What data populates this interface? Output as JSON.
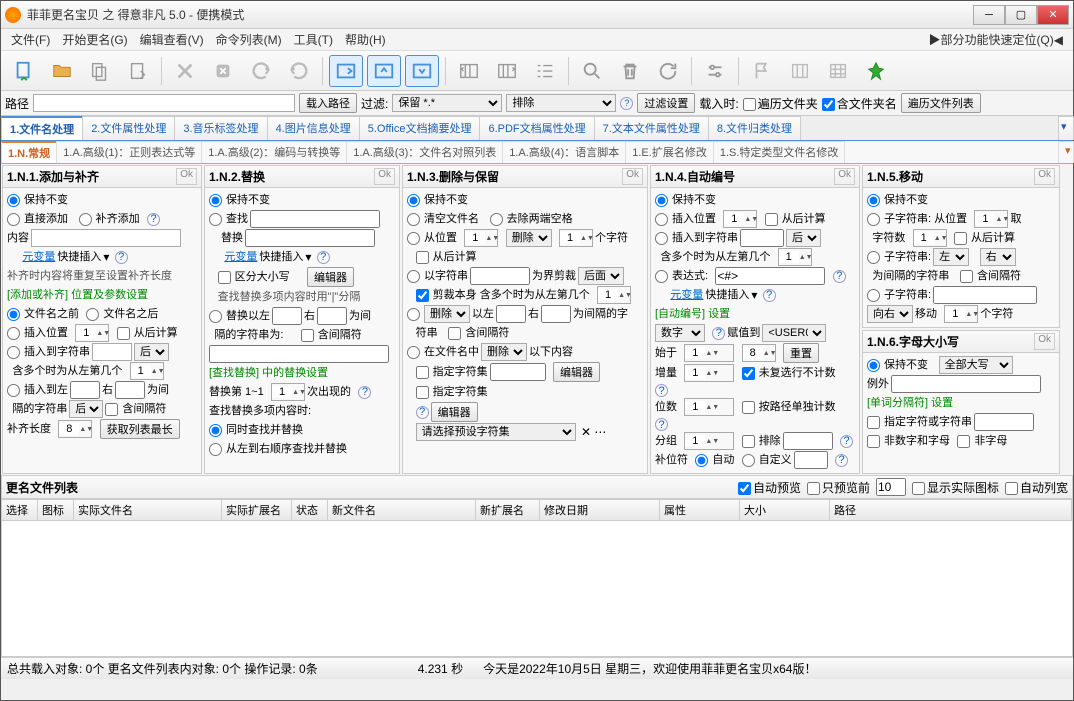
{
  "title": "菲菲更名宝贝 之 得意非凡 5.0 - 便携模式",
  "menu": [
    "文件(F)",
    "开始更名(G)",
    "编辑查看(V)",
    "命令列表(M)",
    "工具(T)",
    "帮助(H)"
  ],
  "menu_right": "▶部分功能快速定位(Q)◀",
  "pathbar": {
    "path_label": "路径",
    "load_path": "载入路径",
    "filter_label": "过滤:",
    "filter_keep": "保留 *.*",
    "sort": "排除",
    "filter_settings": "过滤设置",
    "load_time": "载入时:",
    "recurse": "遍历文件夹",
    "include_dirname": "含文件夹名",
    "recurse_list": "遍历文件列表"
  },
  "tabs1": [
    "1.文件名处理",
    "2.文件属性处理",
    "3.音乐标签处理",
    "4.图片信息处理",
    "5.Office文档摘要处理",
    "6.PDF文档属性处理",
    "7.文本文件属性处理",
    "8.文件归类处理"
  ],
  "tabs2": [
    "1.N.常规",
    "1.A.高级(1)：正则表达式等",
    "1.A.高级(2)：编码与转换等",
    "1.A.高级(3)：文件名对照列表",
    "1.A.高级(4)：语言脚本",
    "1.E.扩展名修改",
    "1.S.特定类型文件名修改"
  ],
  "p1": {
    "title": "1.N.1.添加与补齐",
    "keep": "保持不变",
    "direct": "直接添加",
    "pad": "补齐添加",
    "content": "内容",
    "varlink": "元变量",
    "vartext": "快捷插入",
    "padnote": "补齐时内容将重复至设置补齐长度",
    "section": "[添加或补齐] 位置及参数设置",
    "before": "文件名之前",
    "after": "文件名之后",
    "inspos": "插入位置",
    "fromback": "从后计算",
    "instostr": "插入到字符串",
    "houpos": "后",
    "multi": "含多个时为从左第几个",
    "insleft": "插入到左",
    "insright": "右",
    "between": "为间",
    "gapchar": "隔的字符串",
    "gapback": "后",
    "gapcontain": "含间隔符",
    "padlen": "补齐长度",
    "getmax": "获取列表最长"
  },
  "p2": {
    "title": "1.N.2.替换",
    "keep": "保持不变",
    "find": "查找",
    "replace": "替换",
    "varlink": "元变量",
    "vartext": "快捷插入",
    "casesen": "区分大小写",
    "editor": "编辑器",
    "multinote": "查找替换多项内容时用\"|\"分隔",
    "repleft": "替换以左",
    "repright": "右",
    "between": "为间",
    "gapstr": "隔的字符串为:",
    "gapcontain": "含间隔符",
    "section": "[查找替换] 中的替换设置",
    "repnth": "替换第 1~1",
    "times": "次出现的",
    "repmulti": "查找替换多项内容时:",
    "findrep": "同时查找并替换",
    "ltr": "从左到右顺序查找并替换"
  },
  "p3": {
    "title": "1.N.3.删除与保留",
    "keep": "保持不变",
    "clear": "清空文件名",
    "trim": "去除两端空格",
    "frompos": "从位置",
    "del": "删除",
    "chars": "个字符",
    "fromback": "从后计算",
    "bystr": "以字符串",
    "bound": "为界剪裁",
    "houmian": "后面",
    "cutself": "剪裁本身  含多个时为从左第几个",
    "delword": "删除",
    "left": "以左",
    "right": "右",
    "betweengap": "为间隔的字",
    "strand": "符串",
    "gapcontain": "含间隔符",
    "infile": "在文件名中",
    "anddown": "以下内容",
    "speccharset": "指定字符集",
    "editor": "编辑器",
    "selpreset": "请选择预设字符集"
  },
  "p4": {
    "title": "1.N.4.自动编号",
    "keep": "保持不变",
    "inspos": "插入位置",
    "fromback": "从后计算",
    "instostr": "插入到字符串",
    "houpos": "后",
    "multi": "含多个时为从左第几个",
    "expr": "表达式:",
    "exprval": "<#>",
    "varlink": "元变量",
    "vartext": "快捷插入",
    "section": "[自动编号] 设置",
    "numtype": "数字",
    "assign": "赋值到",
    "userval": "<USER0>",
    "start": "始于",
    "reset": "重置",
    "incr": "增量",
    "norepeat": "未复选行不计数",
    "digits": "位数",
    "perrow": "按路径单独计数",
    "group": "分组",
    "sort": "排除",
    "padchar": "补位符",
    "auto": "自动",
    "custom": "自定义"
  },
  "p5": {
    "title": "1.N.5.移动",
    "keep": "保持不变",
    "substr": "子字符串: 从位置",
    "take": "取",
    "charcnt": "字符数",
    "fromback": "从后计算",
    "substr2": "子字符串:",
    "left": "左",
    "right": "右",
    "gapstr": "为间隔的字符串",
    "gapcontain": "含间隔符",
    "substr3": "子字符串:",
    "dir": "向右",
    "move": "移动",
    "chars2": "个字符"
  },
  "p6": {
    "title": "1.N.6.字母大小写",
    "keep": "保持不变",
    "allupper": "全部大写",
    "example": "例外",
    "section": "[单词分隔符] 设置",
    "speccharset": "指定字符或字符串",
    "nondigit": "非数字和字母",
    "nonletter": "非字母"
  },
  "list": {
    "header": "更名文件列表",
    "autoview": "自动预览",
    "previewonly": "只预览前",
    "showicon": "显示实际图标",
    "autowidth": "自动列宽",
    "cols": [
      "选择",
      "图标",
      "实际文件名",
      "实际扩展名",
      "状态",
      "新文件名",
      "新扩展名",
      "修改日期",
      "属性",
      "大小",
      "路径"
    ]
  },
  "status": {
    "loaded": "总共载入对象: 0个  更名文件列表内对象: 0个  操作记录: 0条",
    "time": "4.231 秒",
    "date": "今天是2022年10月5日  星期三，欢迎使用菲菲更名宝贝x64版！"
  },
  "ok": "Ok"
}
